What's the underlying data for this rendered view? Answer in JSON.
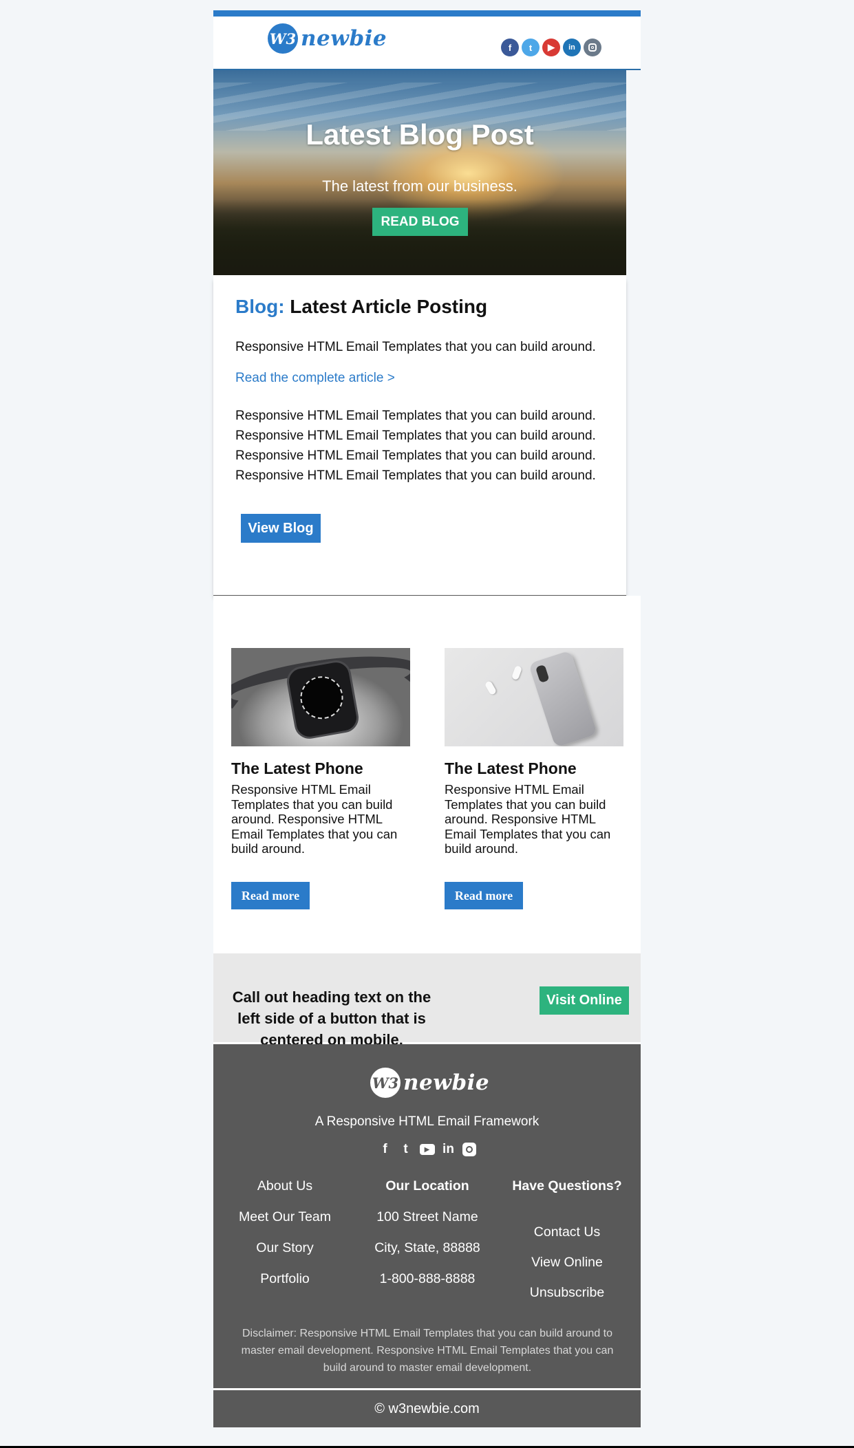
{
  "header": {
    "logo_mark": "W3",
    "logo_word": "newbie",
    "social": [
      "facebook-icon",
      "twitter-icon",
      "youtube-icon",
      "linkedin-icon",
      "instagram-icon"
    ],
    "accent_color": "#2b7bc9"
  },
  "hero": {
    "title": "Latest Blog Post",
    "subtitle": "The latest from our business.",
    "button": "READ BLOG"
  },
  "article": {
    "title_prefix": "Blog:",
    "title_main": " Latest Article Posting",
    "intro": "Responsive HTML Email Templates that you can build around.",
    "link": "Read the complete article >",
    "lines": [
      "Responsive HTML Email Templates that you can build around.",
      "Responsive HTML Email Templates that you can build around.",
      "Responsive HTML Email Templates that you can build around.",
      "Responsive HTML Email Templates that you can build around."
    ],
    "button": "View Blog"
  },
  "products": [
    {
      "title": "The Latest Phone",
      "text": "Responsive HTML Email Templates that you can build around. Responsive HTML Email Templates that you can build around.",
      "button": "Read more"
    },
    {
      "title": "The Latest Phone",
      "text": "Responsive HTML Email Templates that you can build around. Responsive HTML Email Templates that you can build around.",
      "button": "Read more"
    }
  ],
  "callout": {
    "text": "Call out heading text on the left side of a button that is centered on mobile.",
    "button": "Visit Online",
    "button_color": "#2db37e"
  },
  "footer": {
    "logo_mark": "W3",
    "logo_word": "newbie",
    "tagline": "A Responsive HTML Email Framework",
    "col1": [
      "About Us",
      "Meet Our Team",
      "Our Story",
      "Portfolio"
    ],
    "col2": {
      "heading": "Our Location",
      "items": [
        "100 Street Name",
        "City, State, 88888",
        "1-800-888-8888"
      ]
    },
    "col3": {
      "heading": "Have Questions?",
      "items": [
        "Contact Us",
        "View Online",
        "Unsubscribe"
      ]
    },
    "disclaimer": "Disclaimer: Responsive HTML Email Templates that you can build around to master email development. Responsive HTML Email Templates that you can build around to master email development.",
    "copyright": "© w3newbie.com",
    "background": "#595959"
  }
}
